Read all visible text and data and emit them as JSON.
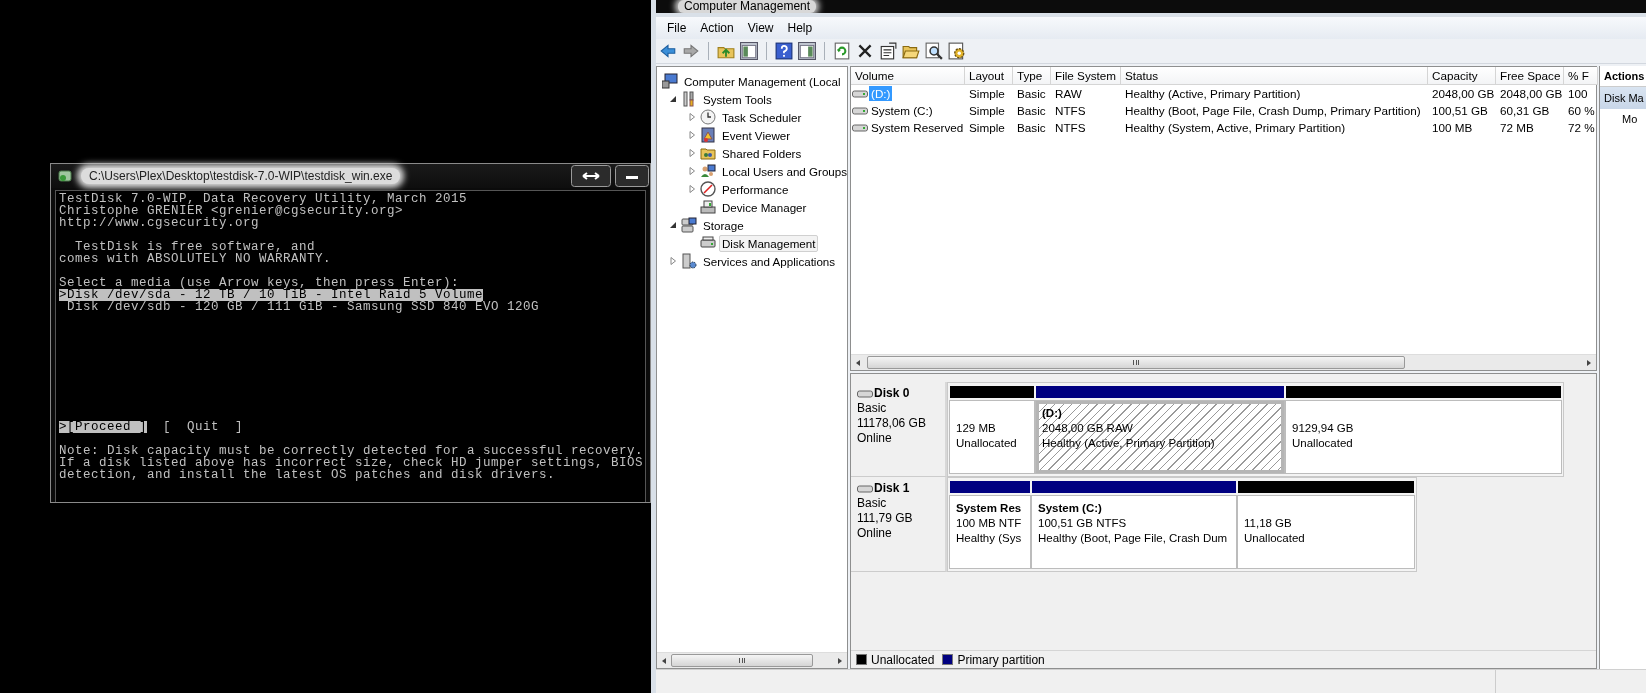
{
  "terminal": {
    "title": "C:\\Users\\Plex\\Desktop\\testdisk-7.0-WIP\\testdisk_win.exe",
    "header_lines": [
      "TestDisk 7.0-WIP, Data Recovery Utility, March 2015",
      "Christophe GRENIER <grenier@cgsecurity.org>",
      "http://www.cgsecurity.org"
    ],
    "license_lines": [
      "  TestDisk is free software, and",
      "comes with ABSOLUTELY NO WARRANTY."
    ],
    "prompt": "Select a media (use Arrow keys, then press Enter):",
    "media": [
      {
        "label": ">Disk /dev/sda - 12 TB / 10 TiB - Intel Raid 5 Volume",
        "selected": true
      },
      {
        "label": " Disk /dev/sdb - 120 GB / 111 GiB - Samsung SSD 840 EVO 120G",
        "selected": false
      }
    ],
    "actions": [
      {
        "label": ">[Proceed ]",
        "selected": true
      },
      {
        "label": "[  Quit  ]",
        "selected": false
      }
    ],
    "note_lines": [
      "Note: Disk capacity must be correctly detected for a successful recovery.",
      "If a disk listed above has incorrect size, check HD jumper settings, BIOS",
      "detection, and install the latest OS patches and disk drivers."
    ]
  },
  "cm": {
    "title": "Computer Management",
    "menu": [
      "File",
      "Action",
      "View",
      "Help"
    ],
    "tree": [
      {
        "label": "Computer Management (Local",
        "selected": false,
        "children": [
          {
            "label": "System Tools",
            "expanded": true,
            "selected": false,
            "children": [
              {
                "label": "Task Scheduler",
                "expanded": false,
                "selected": false
              },
              {
                "label": "Event Viewer",
                "expanded": false,
                "selected": false
              },
              {
                "label": "Shared Folders",
                "expanded": false,
                "selected": false
              },
              {
                "label": "Local Users and Groups",
                "expanded": false,
                "selected": false
              },
              {
                "label": "Performance",
                "expanded": false,
                "selected": false
              },
              {
                "label": "Device Manager",
                "selected": false
              }
            ]
          },
          {
            "label": "Storage",
            "expanded": true,
            "selected": false,
            "children": [
              {
                "label": "Disk Management",
                "selected": true
              }
            ]
          },
          {
            "label": "Services and Applications",
            "expanded": false,
            "selected": false
          }
        ]
      }
    ],
    "volume_columns": [
      "Volume",
      "Layout",
      "Type",
      "File System",
      "Status",
      "Capacity",
      "Free Space",
      "% F"
    ],
    "volumes": [
      {
        "selected": true,
        "cells": [
          "(D:)",
          "Simple",
          "Basic",
          "RAW",
          "Healthy (Active, Primary Partition)",
          "2048,00 GB",
          "2048,00 GB",
          "100"
        ]
      },
      {
        "selected": false,
        "cells": [
          "System (C:)",
          "Simple",
          "Basic",
          "NTFS",
          "Healthy (Boot, Page File, Crash Dump, Primary Partition)",
          "100,51 GB",
          "60,31 GB",
          "60 %"
        ]
      },
      {
        "selected": false,
        "cells": [
          "System Reserved",
          "Simple",
          "Basic",
          "NTFS",
          "Healthy (System, Active, Primary Partition)",
          "100 MB",
          "72 MB",
          "72 %"
        ]
      }
    ],
    "disks": [
      {
        "name": "Disk 0",
        "type": "Basic",
        "size": "11178,06 GB",
        "status": "Online",
        "partitions": [
          {
            "color": "#000000",
            "selected": false,
            "lines": [
              "129 MB",
              "Unallocated"
            ]
          },
          {
            "color": "#000080",
            "selected": true,
            "title": "(D:)",
            "lines": [
              "2048,00 GB RAW",
              "Healthy (Active, Primary Partition)"
            ]
          },
          {
            "color": "#000000",
            "selected": false,
            "lines": [
              "9129,94 GB",
              "Unallocated"
            ]
          }
        ]
      },
      {
        "name": "Disk 1",
        "type": "Basic",
        "size": "111,79 GB",
        "status": "Online",
        "partitions": [
          {
            "color": "#000080",
            "selected": false,
            "title": "System Res",
            "lines": [
              "100 MB NTF",
              "Healthy (Sys"
            ]
          },
          {
            "color": "#000080",
            "selected": false,
            "title": "System  (C:)",
            "lines": [
              "100,51 GB NTFS",
              "Healthy (Boot, Page File, Crash Dum"
            ]
          },
          {
            "color": "#000000",
            "selected": false,
            "lines": [
              "11,18 GB",
              "Unallocated"
            ]
          }
        ]
      }
    ],
    "legend": [
      {
        "label": "Unallocated",
        "color": "#000000"
      },
      {
        "label": "Primary partition",
        "color": "#000080"
      }
    ],
    "actions_pane": {
      "title": "Actions",
      "items": [
        {
          "kind": "section",
          "label": "Disk Ma"
        },
        {
          "kind": "item",
          "label": "Mo"
        }
      ]
    }
  }
}
